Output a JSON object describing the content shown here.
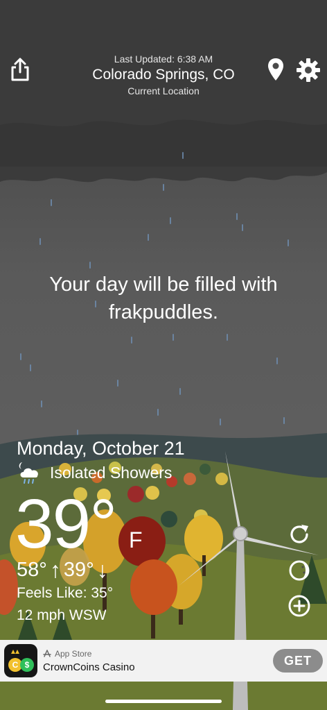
{
  "header": {
    "last_updated": "Last Updated: 6:38 AM",
    "city": "Colorado Springs, CO",
    "current_location": "Current Location"
  },
  "message": "Your day will be filled with frakpuddles.",
  "weather": {
    "date": "Monday, October 21",
    "condition": "Isolated Showers",
    "temperature": "39°",
    "unit": "F",
    "high": "58°",
    "low": "39°",
    "feels_like": "Feels Like: 35°",
    "wind": "12 mph WSW"
  },
  "icons": {
    "share": "share-icon",
    "location": "location-pin-icon",
    "settings": "gear-icon",
    "condition": "moon-cloud-rain-icon",
    "refresh": "refresh-icon",
    "moon": "moon-phase-icon",
    "add": "plus-circle-icon"
  },
  "ad": {
    "store": "App Store",
    "app_name": "CrownCoins Casino",
    "cta": "GET"
  },
  "colors": {
    "sky": "#4d4d4d",
    "hills": "#556b2f",
    "ad_button": "#8c8c8c"
  }
}
